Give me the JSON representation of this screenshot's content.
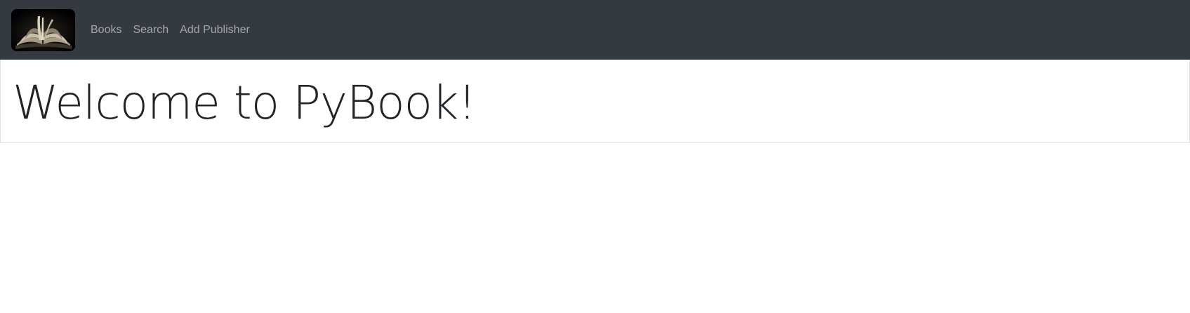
{
  "navbar": {
    "logo_icon": "open-book-logo",
    "links": [
      {
        "label": "Books"
      },
      {
        "label": "Search"
      },
      {
        "label": "Add Publisher"
      }
    ],
    "background": "#343a40",
    "link_color": "rgba(255,255,255,0.55)"
  },
  "hero": {
    "title": "Welcome to PyBook!"
  }
}
